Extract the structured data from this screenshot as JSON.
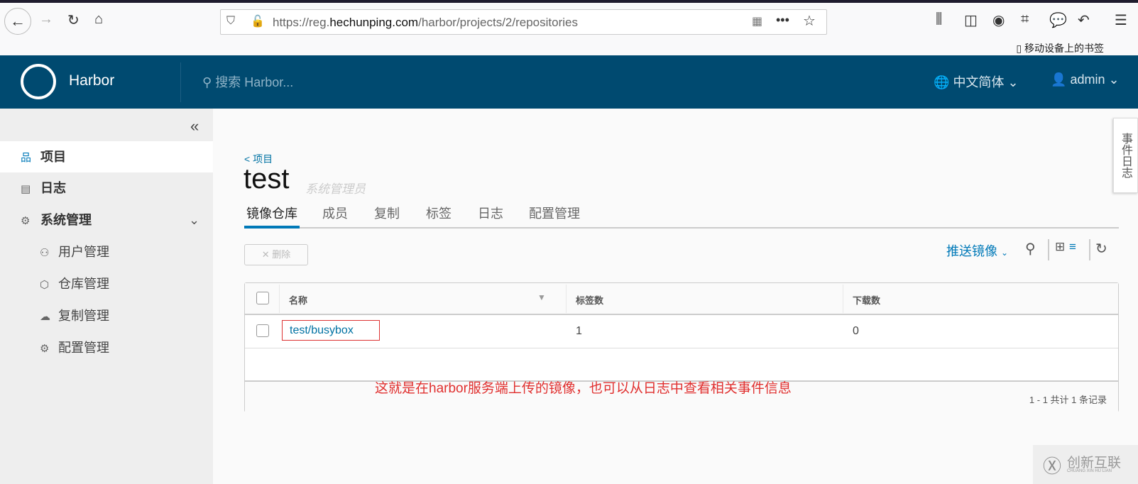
{
  "browser": {
    "url_prefix": "https://reg.",
    "url_domain": "hechunping.com",
    "url_path": "/harbor/projects/2/repositories",
    "mobile_bookmarks": "移动设备上的书签"
  },
  "header": {
    "brand": "Harbor",
    "search_placeholder": "搜索 Harbor...",
    "language": "中文简体",
    "user": "admin"
  },
  "sidebar": {
    "items": [
      {
        "label": "项目"
      },
      {
        "label": "日志"
      },
      {
        "label": "系统管理"
      }
    ],
    "sub_items": [
      {
        "label": "用户管理"
      },
      {
        "label": "仓库管理"
      },
      {
        "label": "复制管理"
      },
      {
        "label": "配置管理"
      }
    ]
  },
  "main": {
    "breadcrumb": "< 项目",
    "title": "test",
    "role": "系统管理员",
    "tabs": [
      {
        "label": "镜像仓库"
      },
      {
        "label": "成员"
      },
      {
        "label": "复制"
      },
      {
        "label": "标签"
      },
      {
        "label": "日志"
      },
      {
        "label": "配置管理"
      }
    ],
    "delete_label": "删除",
    "push_label": "推送镜像",
    "table": {
      "columns": [
        "名称",
        "标签数",
        "下载数"
      ],
      "rows": [
        {
          "name": "test/busybox",
          "tags": "1",
          "downloads": "0"
        }
      ],
      "footer": "1 - 1 共计 1 条记录"
    },
    "annotation": "这就是在harbor服务端上传的镜像，也可以从日志中查看相关事件信息"
  },
  "event_log_tab": "事件日志",
  "watermark": {
    "cn": "创新互联",
    "en": "CHUANG XIN HU LIAN"
  },
  "colors": {
    "header": "#004a70",
    "accent": "#0079b8",
    "annotation": "#e0302f"
  }
}
